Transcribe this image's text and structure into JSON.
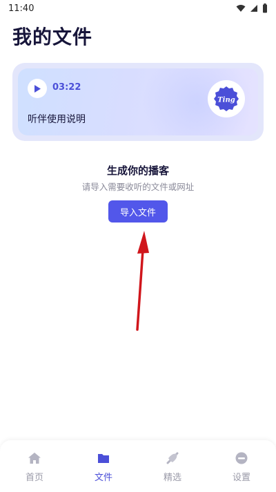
{
  "status_bar": {
    "time": "11:40"
  },
  "page": {
    "title": "我的文件"
  },
  "guide_card": {
    "duration": "03:22",
    "title": "听伴使用说明",
    "badge_text": "Ting"
  },
  "empty_state": {
    "title": "生成你的播客",
    "subtitle": "请导入需要收听的文件或网址",
    "import_button": "导入文件"
  },
  "bottom_nav": [
    {
      "label": "首页",
      "icon": "home-icon",
      "active": false
    },
    {
      "label": "文件",
      "icon": "folder-icon",
      "active": true
    },
    {
      "label": "精选",
      "icon": "featured-icon",
      "active": false
    },
    {
      "label": "设置",
      "icon": "settings-icon",
      "active": false
    }
  ],
  "colors": {
    "accent": "#5257ea",
    "nav_inactive": "#9a9aa8",
    "annotation_arrow": "#d0161c"
  }
}
